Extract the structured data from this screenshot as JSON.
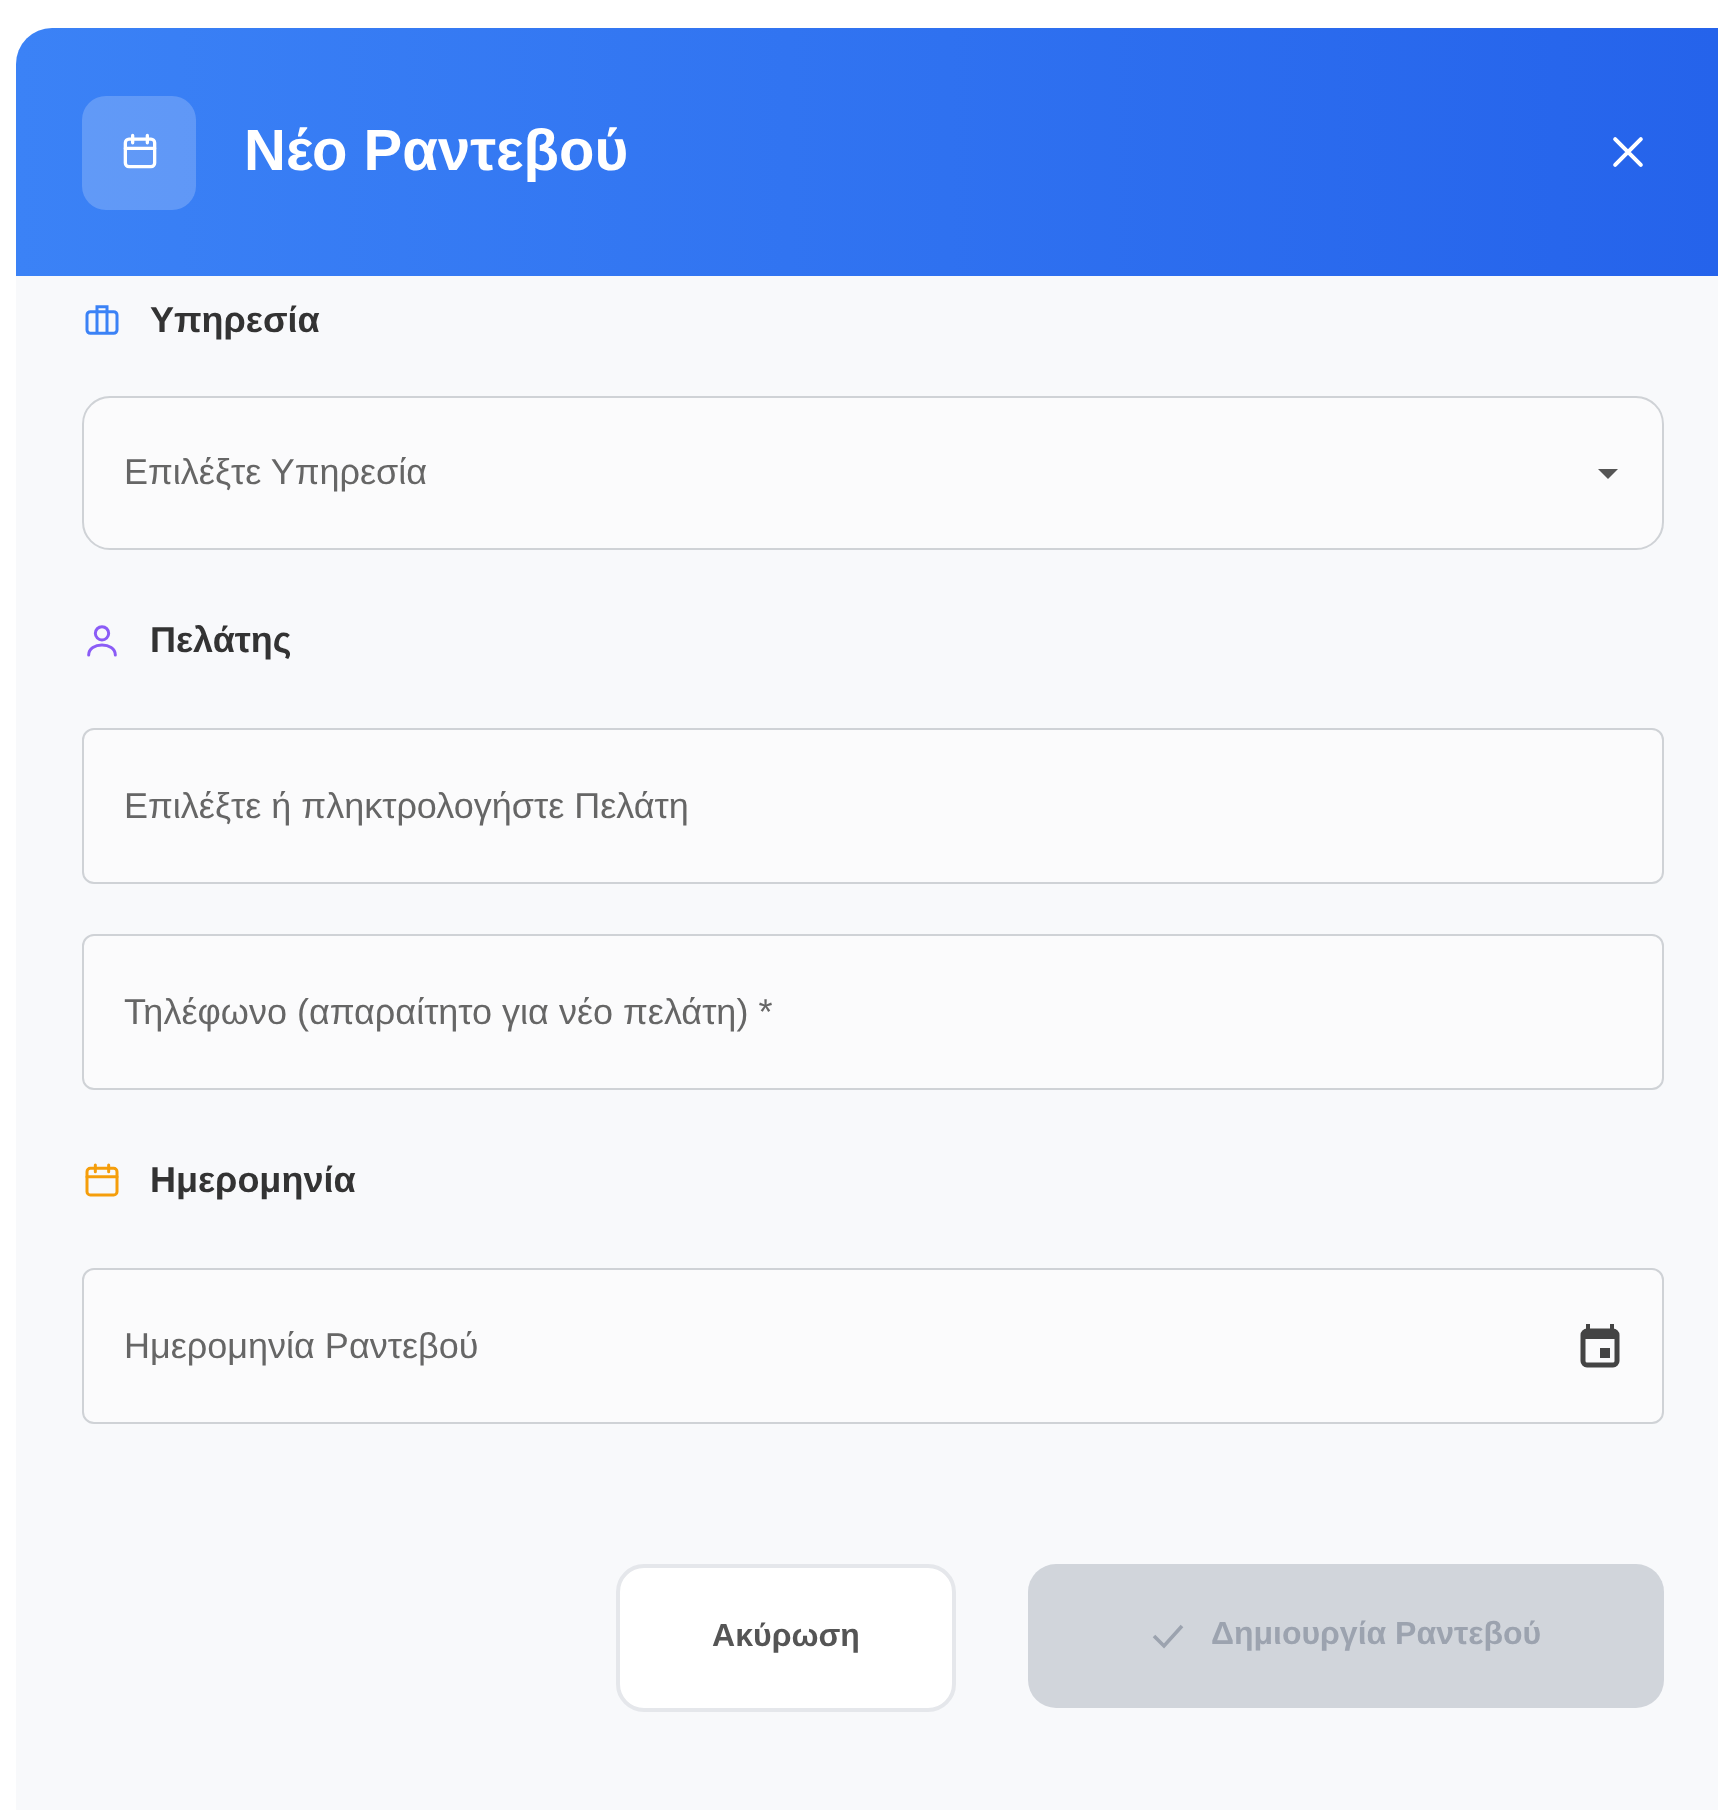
{
  "dialog": {
    "title": "Νέο Ραντεβού",
    "sections": [
      {
        "kind": "service",
        "label": "Υπηρεσία",
        "color": "#3b82f6",
        "fields": [
          {
            "kind": "select",
            "placeholder": "Επιλέξτε Υπηρεσία"
          }
        ]
      },
      {
        "kind": "client",
        "label": "Πελάτης",
        "color": "#8b5cf6",
        "fields": [
          {
            "kind": "text",
            "placeholder": "Επιλέξτε ή πληκτρολογήστε Πελάτη"
          },
          {
            "kind": "text",
            "placeholder": "Τηλέφωνο (απαραίτητο για νέο πελάτη) *"
          }
        ]
      },
      {
        "kind": "date",
        "label": "Ημερομηνία",
        "color": "#f59e0b",
        "fields": [
          {
            "kind": "date",
            "placeholder": "Ημερομηνία Ραντεβού"
          }
        ]
      }
    ],
    "buttons": [
      {
        "kind": "secondary",
        "label": "Ακύρωση",
        "disabled": false
      },
      {
        "kind": "primary",
        "label": "Δημιουργία Ραντεβού",
        "disabled": true
      }
    ]
  }
}
